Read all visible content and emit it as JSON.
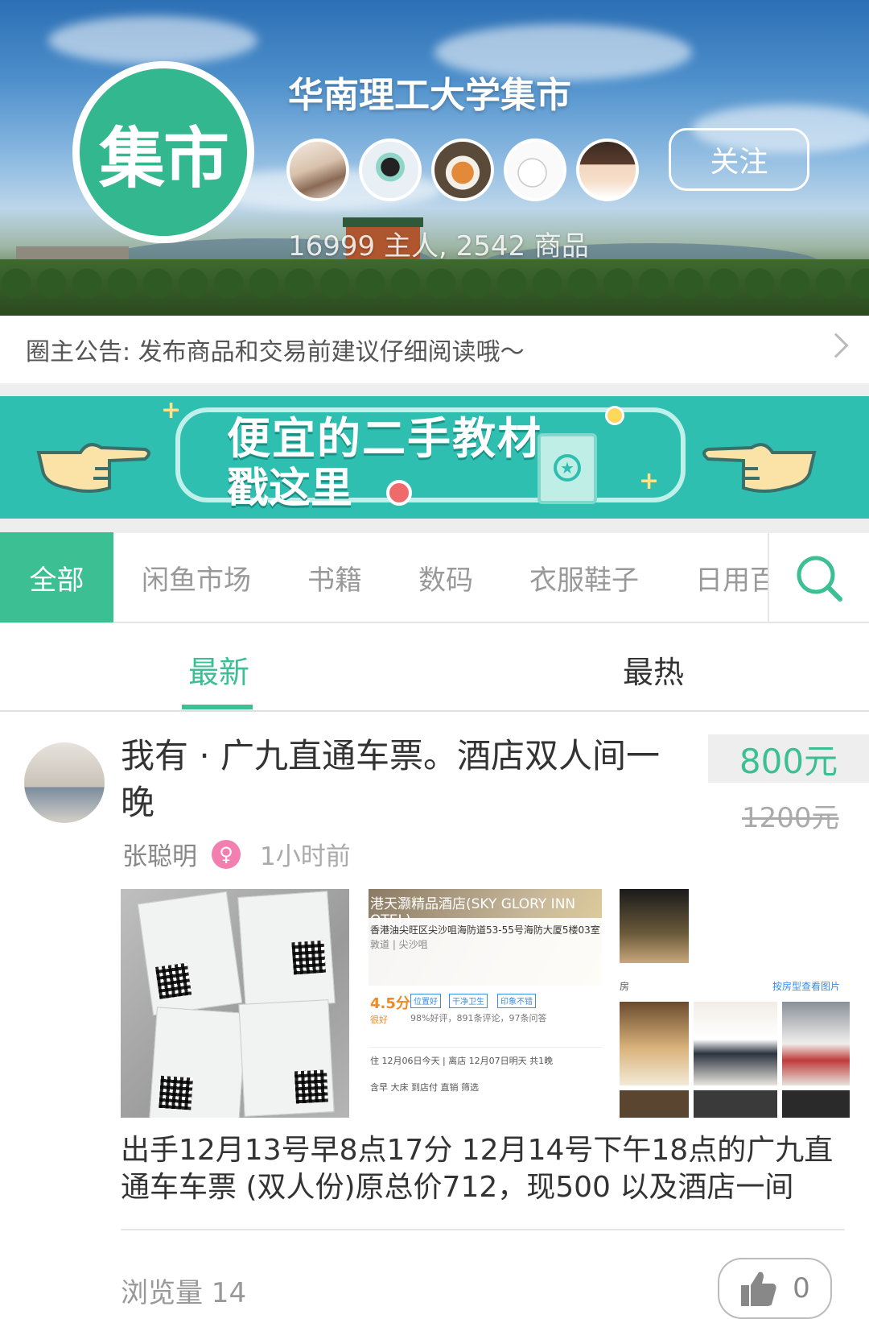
{
  "header": {
    "logo_text": "集市",
    "title": "华南理工大学集市",
    "follow_label": "关注",
    "stats": "16999 主人, 2542 商品",
    "member_avatars": [
      "avatar-1",
      "avatar-2",
      "avatar-3",
      "avatar-4",
      "avatar-5"
    ]
  },
  "notice": {
    "text": "圈主公告: 发布商品和交易前建议仔细阅读哦～"
  },
  "banner": {
    "line1": "便宜的二手教材",
    "line2": "戳这里"
  },
  "categories": {
    "active": "全部",
    "items": [
      "闲鱼市场",
      "书籍",
      "数码",
      "衣服鞋子",
      "日用百"
    ]
  },
  "sort_tabs": {
    "latest": "最新",
    "hot": "最热"
  },
  "post": {
    "title": "我有 · 广九直通车票。酒店双人间一晚",
    "price": "800元",
    "original_price": "1200元",
    "author": "张聪明",
    "gender_symbol": "♀",
    "time": "1小时前",
    "photo2": {
      "hotel_name": "港天灏精品酒店(SKY GLORY INN OTEL)",
      "address": "香港油尖旺区尖沙咀海防道53-55号海防大厦5楼03室",
      "area": "敦道 | 尖沙咀",
      "score": "4.5分",
      "score_label": "很好",
      "tags": [
        "位置好",
        "干净卫生",
        "印象不错"
      ],
      "reviews": "98%好评，891条评论，97条问答",
      "dates": "住 12月06日今天  |  离店 12月07日明天      共1晚",
      "filters": "含早    大床    到店付    直销        筛选"
    },
    "photo3": {
      "label": "房",
      "link": "按房型查看图片"
    },
    "description": "出手12月13号早8点17分 12月14号下午18点的广九直通车车票 (双人份)原总价712，现500 以及酒店一间",
    "views": "浏览量 14",
    "likes": "0"
  },
  "colors": {
    "accent": "#3cbf93",
    "banner": "#2fbfb0",
    "gender_female": "#f27fb0"
  }
}
